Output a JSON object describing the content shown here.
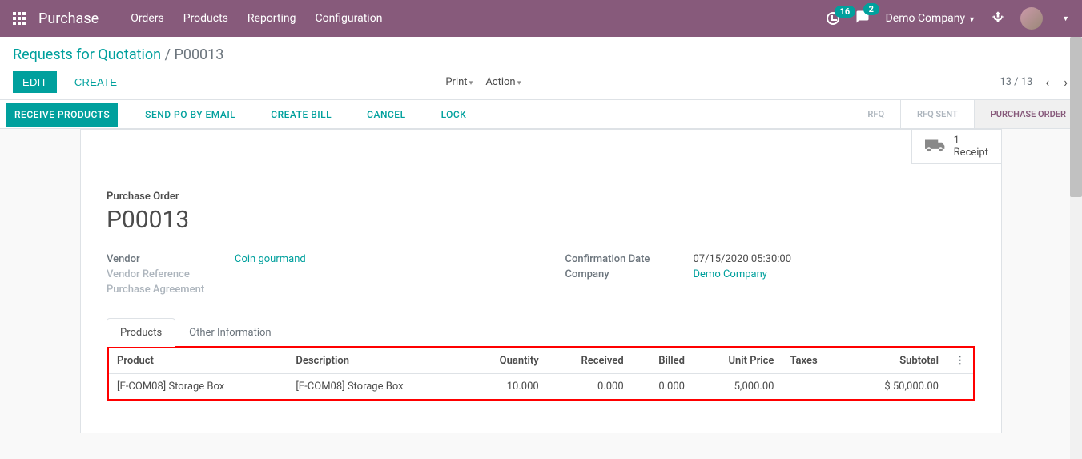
{
  "nav": {
    "brand": "Purchase",
    "menu": [
      "Orders",
      "Products",
      "Reporting",
      "Configuration"
    ],
    "notif_count": "16",
    "chat_count": "2",
    "company": "Demo Company"
  },
  "breadcrumb": {
    "root": "Requests for Quotation",
    "current": "P00013"
  },
  "buttons": {
    "edit": "Edit",
    "create": "Create",
    "print": "Print",
    "action": "Action"
  },
  "pager": {
    "text": "13 / 13"
  },
  "action_buttons": {
    "receive": "Receive Products",
    "send_po": "Send PO by Email",
    "create_bill": "Create Bill",
    "cancel": "Cancel",
    "lock": "Lock"
  },
  "status": {
    "rfq": "RFQ",
    "rfq_sent": "RFQ SENT",
    "po": "PURCHASE ORDER"
  },
  "receipt": {
    "count": "1",
    "label": "Receipt"
  },
  "order": {
    "title_label": "Purchase Order",
    "name": "P00013",
    "vendor_label": "Vendor",
    "vendor": "Coin gourmand",
    "vendor_ref_label": "Vendor Reference",
    "agreement_label": "Purchase Agreement",
    "conf_date_label": "Confirmation Date",
    "conf_date": "07/15/2020 05:30:00",
    "company_label": "Company",
    "company": "Demo Company"
  },
  "tabs": {
    "products": "Products",
    "other": "Other Information"
  },
  "table": {
    "headers": {
      "product": "Product",
      "description": "Description",
      "quantity": "Quantity",
      "received": "Received",
      "billed": "Billed",
      "unit_price": "Unit Price",
      "taxes": "Taxes",
      "subtotal": "Subtotal"
    },
    "rows": [
      {
        "product": "[E-COM08] Storage Box",
        "description": "[E-COM08] Storage Box",
        "quantity": "10.000",
        "received": "0.000",
        "billed": "0.000",
        "unit_price": "5,000.00",
        "taxes": "",
        "subtotal": "$ 50,000.00"
      }
    ]
  }
}
